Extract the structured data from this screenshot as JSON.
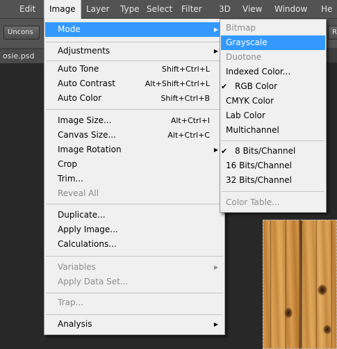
{
  "menubar": {
    "items": [
      "Edit",
      "Image",
      "Layer",
      "Type",
      "Select",
      "Filter",
      "3D",
      "View",
      "Window",
      "He"
    ]
  },
  "options": {
    "left_button": "Uncons",
    "right_button": "R"
  },
  "document": {
    "tab_label": "osie.psd"
  },
  "image_menu": {
    "items": [
      {
        "label": "Mode",
        "submenu": true,
        "highlight": true
      },
      {
        "label": "Adjustments",
        "submenu": true
      },
      {
        "label": "Auto Tone",
        "shortcut": "Shift+Ctrl+L"
      },
      {
        "label": "Auto Contrast",
        "shortcut": "Alt+Shift+Ctrl+L"
      },
      {
        "label": "Auto Color",
        "shortcut": "Shift+Ctrl+B"
      },
      {
        "label": "Image Size...",
        "shortcut": "Alt+Ctrl+I"
      },
      {
        "label": "Canvas Size...",
        "shortcut": "Alt+Ctrl+C"
      },
      {
        "label": "Image Rotation",
        "submenu": true
      },
      {
        "label": "Crop"
      },
      {
        "label": "Trim..."
      },
      {
        "label": "Reveal All",
        "disabled": true
      },
      {
        "label": "Duplicate..."
      },
      {
        "label": "Apply Image..."
      },
      {
        "label": "Calculations..."
      },
      {
        "label": "Variables",
        "submenu": true,
        "disabled": true
      },
      {
        "label": "Apply Data Set...",
        "disabled": true
      },
      {
        "label": "Trap...",
        "disabled": true
      },
      {
        "label": "Analysis",
        "submenu": true
      }
    ]
  },
  "mode_menu": {
    "items": [
      {
        "label": "Bitmap",
        "disabled": true
      },
      {
        "label": "Grayscale",
        "highlight": true
      },
      {
        "label": "Duotone",
        "disabled": true
      },
      {
        "label": "Indexed Color..."
      },
      {
        "label": "RGB Color",
        "checked": true
      },
      {
        "label": "CMYK Color"
      },
      {
        "label": "Lab Color"
      },
      {
        "label": "Multichannel"
      },
      {
        "label": "8 Bits/Channel",
        "checked": true
      },
      {
        "label": "16 Bits/Channel"
      },
      {
        "label": "32 Bits/Channel"
      },
      {
        "label": "Color Table...",
        "disabled": true
      }
    ]
  },
  "icons": {
    "submenu_arrow": "chevron-right-icon",
    "check": "check-icon"
  },
  "colors": {
    "highlight": "#3399ff",
    "menu_bg": "#f0f0f0",
    "disabled_text": "#8c8c8c",
    "app_bg": "#282828",
    "bar_bg": "#535353"
  }
}
